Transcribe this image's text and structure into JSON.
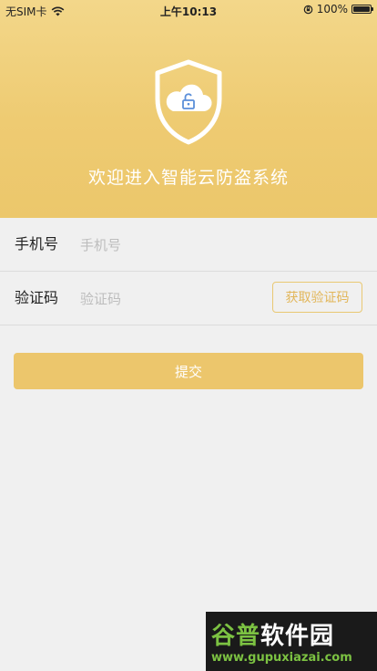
{
  "status_bar": {
    "carrier": "无SIM卡",
    "time": "上午10:13",
    "battery": "100%",
    "icons": [
      "wifi-icon",
      "rotation-lock-icon",
      "battery-icon"
    ]
  },
  "header": {
    "welcome": "欢迎进入智能云防盗系统",
    "icon": "shield-cloud-lock-icon",
    "colors": {
      "background": "#eecb72",
      "accent": "#5b8fd9"
    }
  },
  "form": {
    "phone": {
      "label": "手机号",
      "placeholder": "手机号",
      "value": ""
    },
    "code": {
      "label": "验证码",
      "placeholder": "验证码",
      "value": "",
      "button": "获取验证码"
    },
    "submit": "提交"
  },
  "watermark": {
    "part1": "谷普",
    "part2": "软件园",
    "url": "www.gupuxiazai.com"
  }
}
